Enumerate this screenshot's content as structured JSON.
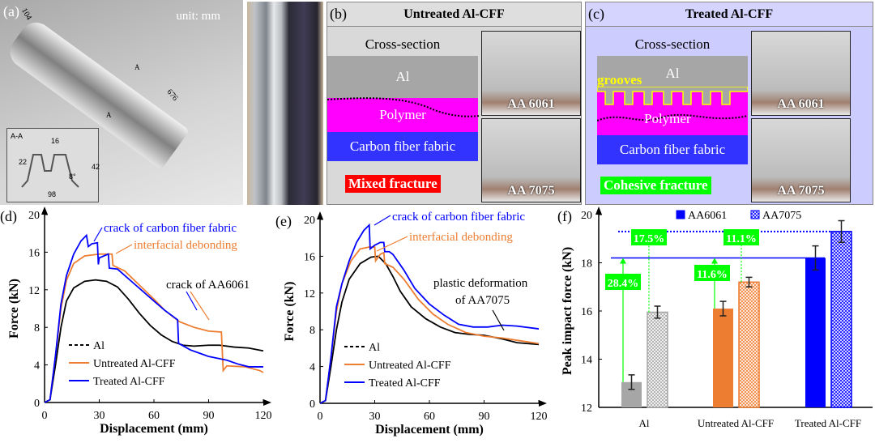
{
  "panel_a": {
    "label": "(a)",
    "unit": "unit: mm",
    "dims": [
      "104",
      "676",
      "A",
      "A"
    ],
    "inset": {
      "title": "A-A",
      "dims": [
        "16",
        "22",
        "42",
        "8°",
        "98"
      ]
    }
  },
  "panel_b": {
    "label": "(b)",
    "title": "Untreated Al-CFF",
    "cross_section": "Cross-section",
    "layers": [
      "Al",
      "Polymer",
      "Carbon fiber fabric"
    ],
    "fracture": "Mixed fracture",
    "photos": [
      "AA 6061",
      "AA 7075"
    ],
    "colors": {
      "al": "#a6a6a6",
      "polymer": "#ff00ff",
      "cff": "#3333ff",
      "fracture_bg": "#ff0000"
    }
  },
  "panel_c": {
    "label": "(c)",
    "title": "Treated Al-CFF",
    "cross_section": "Cross-section",
    "grooves": "grooves",
    "layers": [
      "Al",
      "Polymer",
      "Carbon fiber fabric"
    ],
    "fracture": "Cohesive fracture",
    "photos": [
      "AA 6061",
      "AA 7075"
    ],
    "colors": {
      "fracture_bg": "#00ff00"
    }
  },
  "chart_data": [
    {
      "panel": "(d)",
      "type": "line",
      "xlabel": "Displacement (mm)",
      "ylabel": "Force (kN)",
      "xlim": [
        0,
        120
      ],
      "ylim": [
        0,
        20
      ],
      "xticks": [
        0,
        30,
        60,
        90,
        120
      ],
      "yticks": [
        0,
        4,
        8,
        12,
        16,
        20
      ],
      "legend": "bottom-left",
      "annotations": [
        {
          "text": "crack of carbon fiber fabric",
          "color": "#0000ff"
        },
        {
          "text": "interfacial debonding",
          "color": "#ed7d31"
        },
        {
          "text": "crack of AA6061",
          "color": "#000000"
        }
      ],
      "series": [
        {
          "name": "Al",
          "color": "#000000",
          "style": "dashed",
          "points": [
            [
              0,
              0
            ],
            [
              3,
              0.3
            ],
            [
              6,
              4
            ],
            [
              9,
              8
            ],
            [
              12,
              10.8
            ],
            [
              16,
              12.2
            ],
            [
              22,
              12.9
            ],
            [
              28,
              13.05
            ],
            [
              34,
              12.9
            ],
            [
              40,
              12.3
            ],
            [
              46,
              11
            ],
            [
              52,
              9.5
            ],
            [
              58,
              8.2
            ],
            [
              64,
              7.2
            ],
            [
              70,
              6.5
            ],
            [
              76,
              6.1
            ],
            [
              82,
              6
            ],
            [
              90,
              6.1
            ],
            [
              96,
              6.1
            ],
            [
              104,
              5.9
            ],
            [
              112,
              5.8
            ],
            [
              120,
              5.5
            ]
          ]
        },
        {
          "name": "Untreated Al-CFF",
          "color": "#ed7d31",
          "style": "solid",
          "points": [
            [
              0,
              0
            ],
            [
              3,
              0.3
            ],
            [
              6,
              5
            ],
            [
              9,
              10
            ],
            [
              12,
              13
            ],
            [
              16,
              14.8
            ],
            [
              22,
              15.6
            ],
            [
              30,
              15.8
            ],
            [
              37,
              15.8
            ],
            [
              37.5,
              14.6
            ],
            [
              44,
              14
            ],
            [
              52,
              12.5
            ],
            [
              60,
              11
            ],
            [
              66,
              9.8
            ],
            [
              74,
              8.6
            ],
            [
              82,
              8
            ],
            [
              90,
              7.6
            ],
            [
              97,
              7.5
            ],
            [
              98,
              3.4
            ],
            [
              100,
              3.9
            ],
            [
              110,
              3.8
            ],
            [
              118,
              3.4
            ],
            [
              120,
              3.2
            ]
          ]
        },
        {
          "name": "Treated Al-CFF",
          "color": "#0000ff",
          "style": "solid",
          "points": [
            [
              0,
              0
            ],
            [
              3,
              0.3
            ],
            [
              6,
              5
            ],
            [
              9,
              10.5
            ],
            [
              12,
              13.5
            ],
            [
              16,
              15.8
            ],
            [
              20,
              17.2
            ],
            [
              23,
              17.8
            ],
            [
              24,
              16.6
            ],
            [
              26,
              16.9
            ],
            [
              29,
              17
            ],
            [
              29.5,
              14.7
            ],
            [
              30,
              15.4
            ],
            [
              35,
              15.8
            ],
            [
              35.5,
              14.3
            ],
            [
              40,
              14.2
            ],
            [
              50,
              12.5
            ],
            [
              60,
              10.8
            ],
            [
              66,
              9.8
            ],
            [
              73,
              8.8
            ],
            [
              73.5,
              6.3
            ],
            [
              80,
              5.6
            ],
            [
              90,
              4.9
            ],
            [
              100,
              4.5
            ],
            [
              106,
              4.1
            ],
            [
              112,
              3.8
            ],
            [
              120,
              3.8
            ]
          ]
        }
      ]
    },
    {
      "panel": "(e)",
      "type": "line",
      "xlabel": "Displacement (mm)",
      "ylabel": "Force (kN)",
      "xlim": [
        0,
        120
      ],
      "ylim": [
        0,
        20
      ],
      "xticks": [
        0,
        30,
        60,
        90,
        120
      ],
      "yticks": [
        0,
        4,
        8,
        12,
        16,
        20
      ],
      "legend": "bottom-left",
      "annotations": [
        {
          "text": "crack of carbon fiber fabric",
          "color": "#0000ff"
        },
        {
          "text": "interfacial debonding",
          "color": "#ed7d31"
        },
        {
          "text": "plastic deformation",
          "color": "#000000"
        },
        {
          "text": "of AA7075",
          "color": "#000000"
        }
      ],
      "series": [
        {
          "name": "Al",
          "color": "#000000",
          "style": "dashed",
          "points": [
            [
              0,
              0
            ],
            [
              3,
              0.3
            ],
            [
              6,
              4
            ],
            [
              9,
              8
            ],
            [
              12,
              11
            ],
            [
              16,
              13.5
            ],
            [
              22,
              15.2
            ],
            [
              28,
              15.9
            ],
            [
              32,
              16
            ],
            [
              36,
              15.2
            ],
            [
              40,
              13.8
            ],
            [
              44,
              12.2
            ],
            [
              50,
              10.5
            ],
            [
              58,
              9.2
            ],
            [
              66,
              8.3
            ],
            [
              74,
              7.7
            ],
            [
              82,
              7.5
            ],
            [
              90,
              7.4
            ],
            [
              100,
              7
            ],
            [
              108,
              6.6
            ],
            [
              120,
              6.4
            ]
          ]
        },
        {
          "name": "Untreated Al-CFF",
          "color": "#ed7d31",
          "style": "solid",
          "points": [
            [
              0,
              0
            ],
            [
              3,
              0.3
            ],
            [
              6,
              5
            ],
            [
              9,
              10
            ],
            [
              12,
              13
            ],
            [
              17,
              15.5
            ],
            [
              22,
              16.8
            ],
            [
              27,
              17
            ],
            [
              30,
              17
            ],
            [
              30.5,
              15.5
            ],
            [
              33,
              16.2
            ],
            [
              35,
              16.4
            ],
            [
              35.5,
              15.2
            ],
            [
              40,
              14.8
            ],
            [
              46,
              13.5
            ],
            [
              54,
              11.3
            ],
            [
              62,
              9.7
            ],
            [
              70,
              8.6
            ],
            [
              80,
              7.7
            ],
            [
              90,
              7.3
            ],
            [
              100,
              7.1
            ],
            [
              110,
              6.8
            ],
            [
              120,
              6.5
            ]
          ]
        },
        {
          "name": "Treated Al-CFF",
          "color": "#0000ff",
          "style": "solid",
          "points": [
            [
              0,
              0
            ],
            [
              3,
              0.3
            ],
            [
              6,
              5
            ],
            [
              9,
              10.5
            ],
            [
              12,
              13
            ],
            [
              16,
              15.5
            ],
            [
              20,
              17.5
            ],
            [
              24,
              18.8
            ],
            [
              27,
              19.4
            ],
            [
              27.5,
              16.8
            ],
            [
              30,
              17.2
            ],
            [
              33,
              17.5
            ],
            [
              35,
              17.5
            ],
            [
              35.5,
              16.5
            ],
            [
              38,
              16.5
            ],
            [
              40,
              16.2
            ],
            [
              46,
              14.5
            ],
            [
              52,
              12.5
            ],
            [
              60,
              10.8
            ],
            [
              68,
              9.6
            ],
            [
              76,
              8.6
            ],
            [
              84,
              8.3
            ],
            [
              92,
              8.3
            ],
            [
              100,
              8.5
            ],
            [
              108,
              8.4
            ],
            [
              120,
              8.1
            ]
          ]
        }
      ]
    },
    {
      "panel": "(f)",
      "type": "bar",
      "ylabel": "Peak impact force (kN)",
      "ylim": [
        12,
        20
      ],
      "yticks": [
        12,
        14,
        16,
        18,
        20
      ],
      "categories": [
        "Al",
        "Untreated Al-CFF",
        "Treated Al-CFF"
      ],
      "legend": "top",
      "series": [
        {
          "name": "AA6061",
          "values": [
            13.05,
            16.1,
            18.2
          ],
          "errors": [
            0.3,
            0.3,
            0.5
          ],
          "colors": [
            "#a6a6a6",
            "#ed7d31",
            "#0000ff"
          ],
          "pattern": "solid"
        },
        {
          "name": "AA7075",
          "values": [
            15.95,
            17.2,
            19.3
          ],
          "errors": [
            0.25,
            0.2,
            0.45
          ],
          "colors": [
            "#a6a6a6",
            "#ed7d31",
            "#0000ff"
          ],
          "pattern": "hatched"
        }
      ],
      "annotations": [
        "28.4%",
        "17.5%",
        "11.6%",
        "11.1%"
      ],
      "annotation_color": "#00ff00"
    }
  ]
}
